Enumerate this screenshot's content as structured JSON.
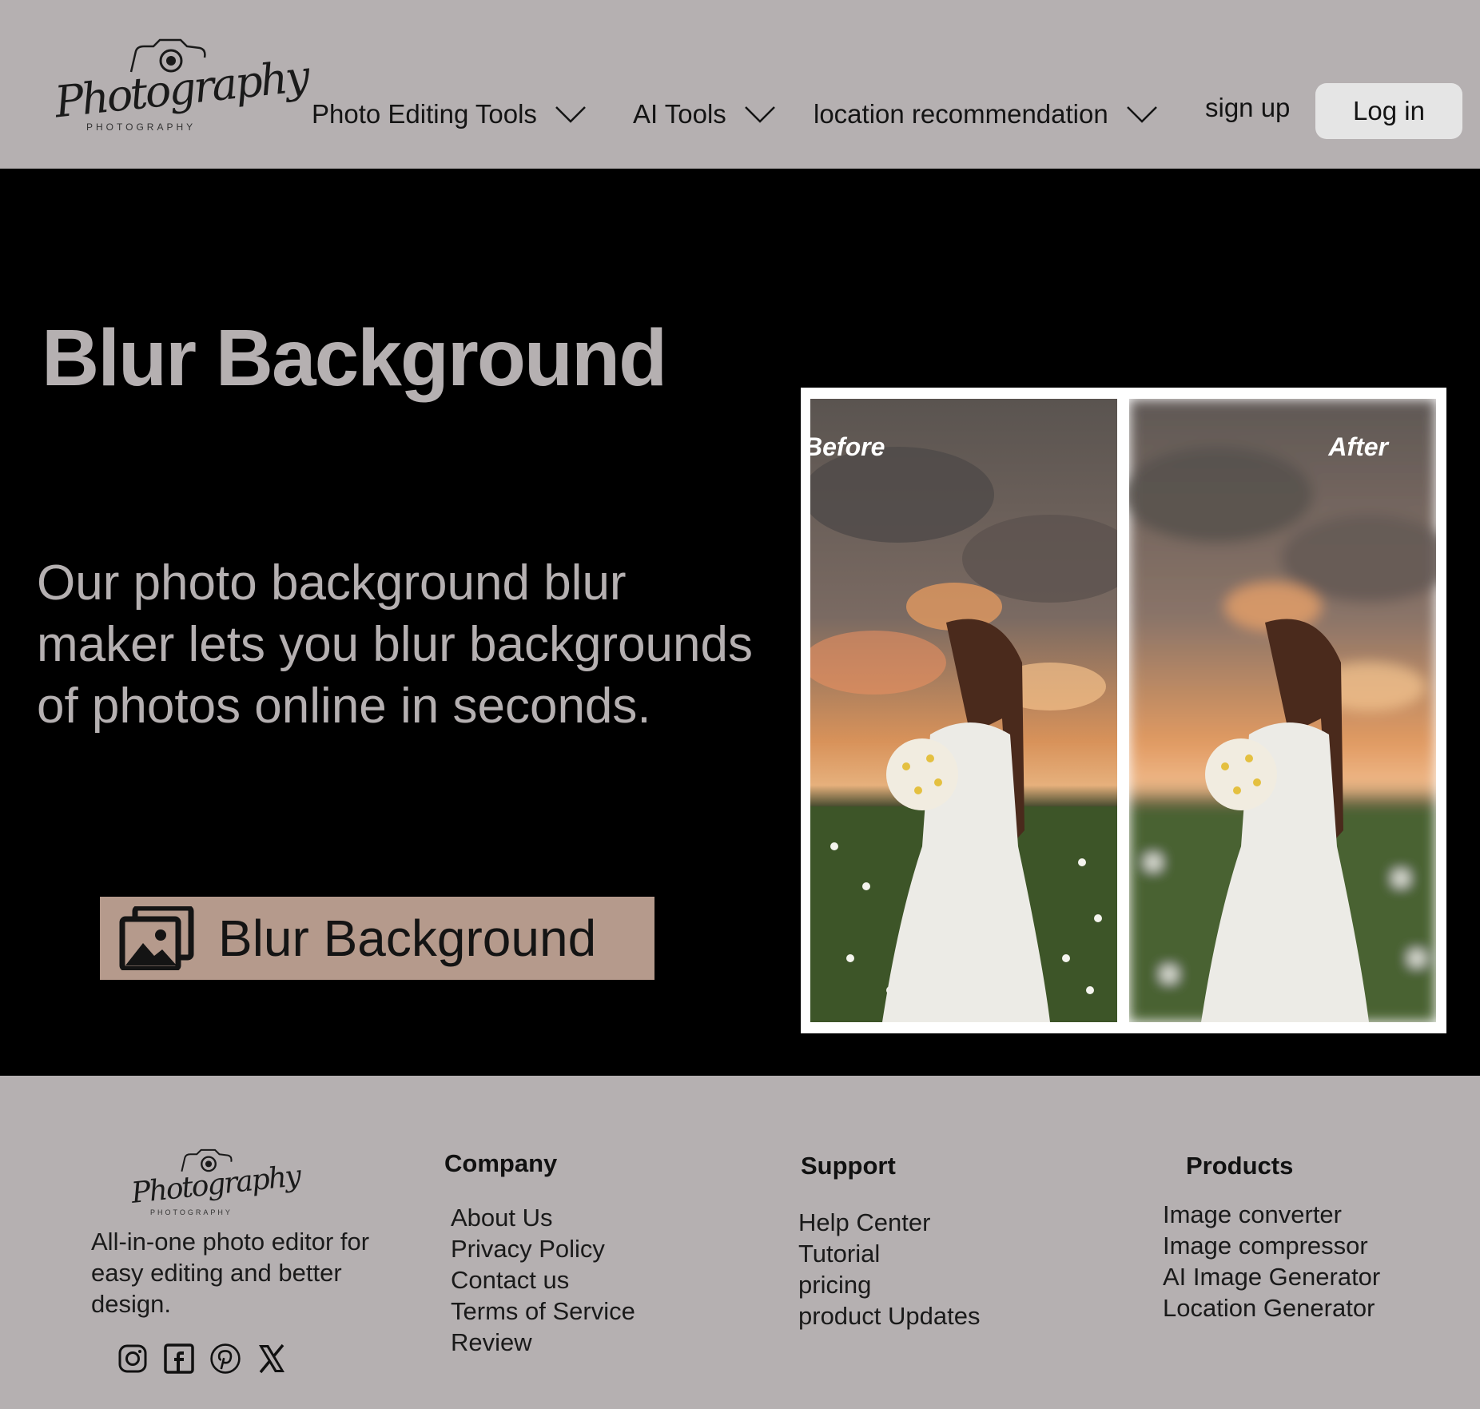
{
  "brand": {
    "logo_script": "Photography",
    "logo_sub": "PHOTOGRAPHY"
  },
  "nav": {
    "items": [
      {
        "label": "Photo Editing Tools"
      },
      {
        "label": "AI Tools"
      },
      {
        "label": "location recommendation"
      }
    ],
    "signup": "sign up",
    "login": "Log in"
  },
  "hero": {
    "title": "Blur Background",
    "description": "Our photo background blur maker lets you blur backgrounds of photos online in seconds.",
    "cta_label": "Blur Background",
    "before_label": "Before",
    "after_label": "After"
  },
  "footer": {
    "tagline": "All-in-one photo editor for easy editing and better design.",
    "socials": [
      "instagram-icon",
      "facebook-icon",
      "pinterest-icon",
      "x-icon"
    ],
    "company": {
      "heading": "Company",
      "links": [
        "About Us",
        "Privacy Policy",
        "Contact us",
        "Terms of Service",
        "Review"
      ]
    },
    "support": {
      "heading": "Support",
      "links": [
        "Help Center",
        "Tutorial",
        "pricing",
        "product Updates"
      ]
    },
    "products": {
      "heading": "Products",
      "links": [
        "Image converter",
        "Image compressor",
        "AI Image Generator",
        "Location Generator"
      ]
    }
  },
  "colors": {
    "background": "#b5b0b1",
    "hero_bg": "#000000",
    "cta_bg": "#b59a8c",
    "login_bg": "#e5e5e5",
    "hero_text": "#b5b0b1"
  }
}
